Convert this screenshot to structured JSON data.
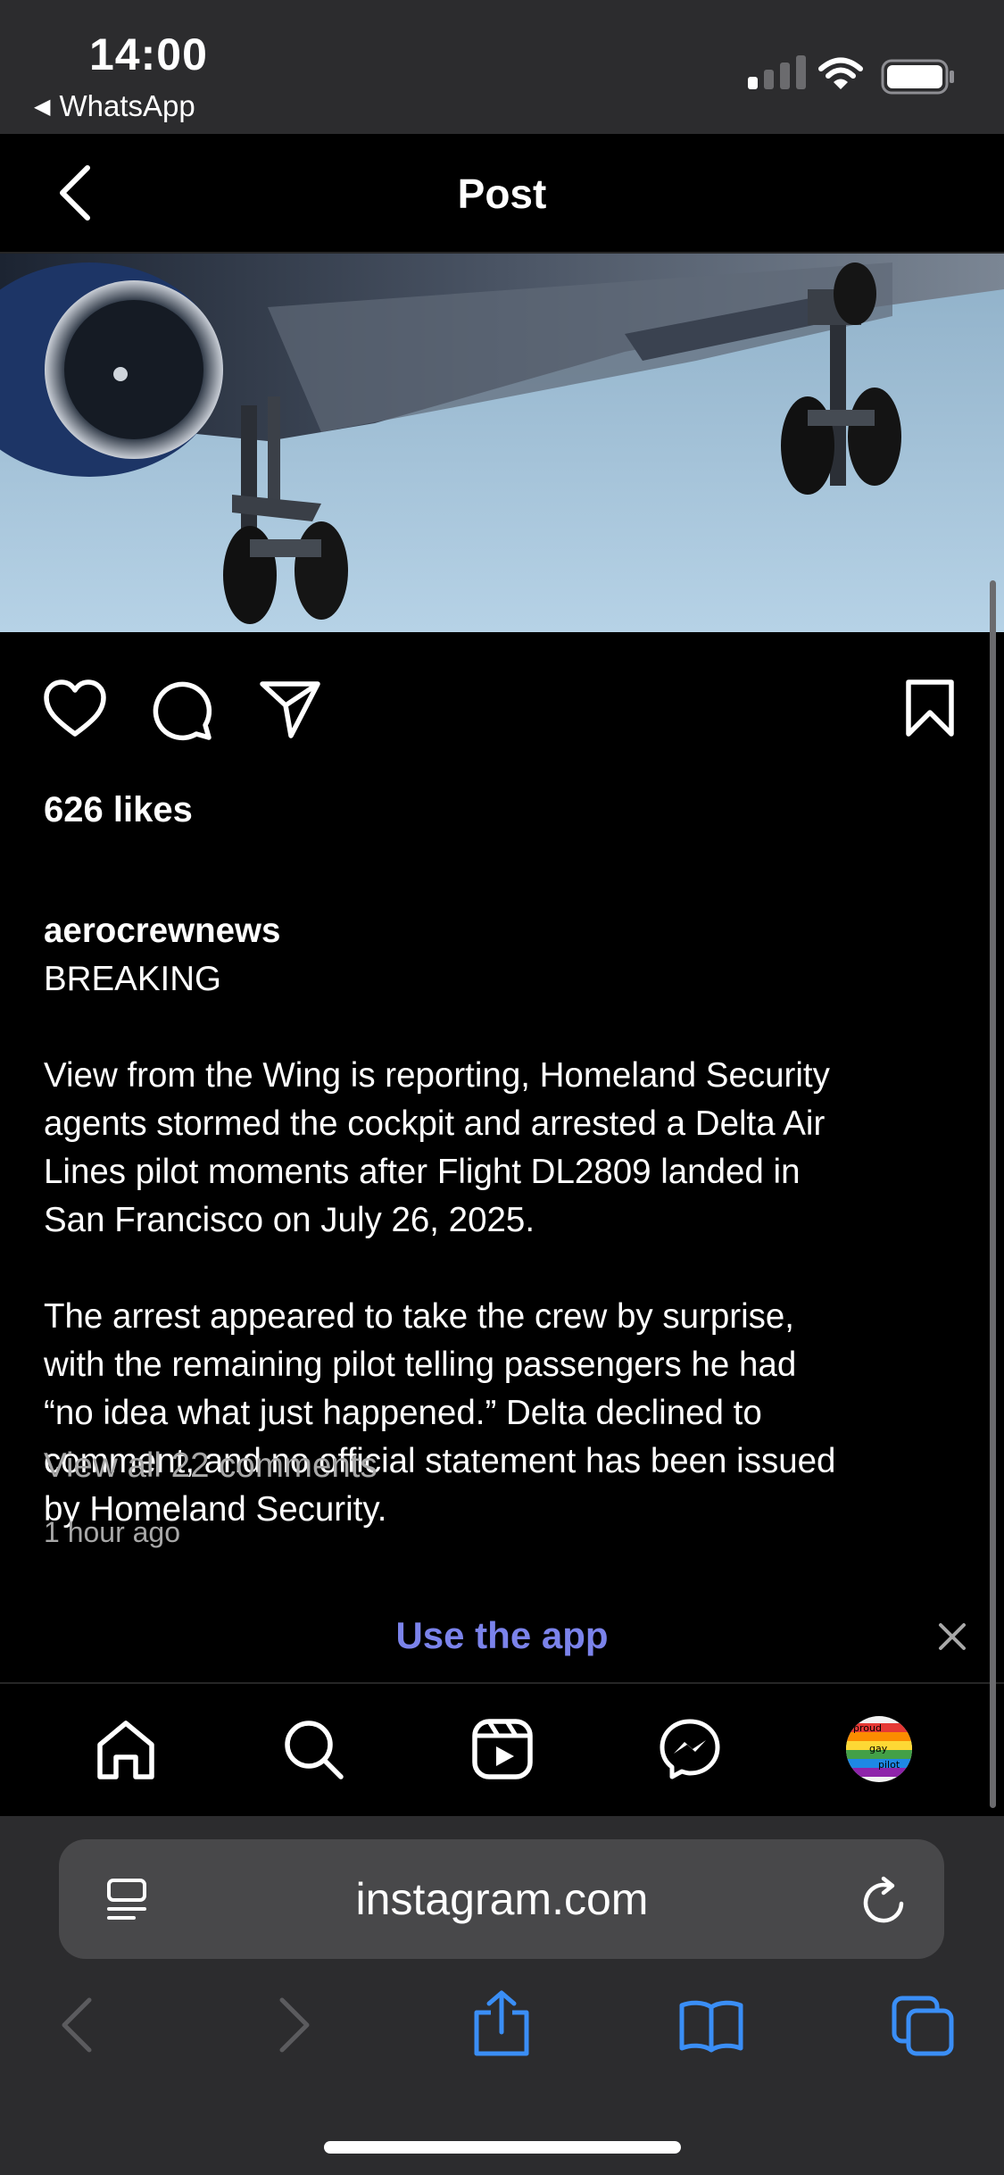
{
  "status_bar": {
    "time": "14:00",
    "back_app": "WhatsApp",
    "icons": [
      "cellular-signal-icon",
      "wifi-icon",
      "battery-icon"
    ]
  },
  "nav": {
    "title": "Post",
    "back_icon": "chevron-left-icon"
  },
  "post": {
    "image_alt": "airplane-undercarriage-photo",
    "actions": [
      "heart-icon",
      "comment-icon",
      "send-icon",
      "bookmark-icon"
    ],
    "likes": "626 likes",
    "username": "aerocrewnews",
    "caption_first_line": "BREAKING",
    "paragraph1": "View from the Wing is reporting, Homeland Security\nagents stormed the cockpit and arrested a Delta Air\nLines pilot moments after Flight DL2809 landed in\nSan Francisco on July 26, 2025.",
    "paragraph2": "The arrest appeared to take the crew by surprise,\nwith the remaining pilot telling passengers he had\n“no idea what just happened.” Delta declined to\ncomment, and no official statement has been issued\nby Homeland Security.",
    "view_comments": "View all 22 comments",
    "time_ago": "1 hour ago"
  },
  "app_banner": {
    "label": "Use the app",
    "close_icon": "close-icon"
  },
  "bottom_nav": {
    "items": [
      "home-icon",
      "search-icon",
      "reels-icon",
      "messenger-icon",
      "profile-avatar"
    ],
    "avatar_text": [
      "proud",
      "gay",
      "pilot"
    ]
  },
  "safari": {
    "url": "instagram.com",
    "icons": [
      "page-menu-icon",
      "reload-icon",
      "back-arrow-icon",
      "forward-arrow-icon",
      "share-icon",
      "bookmarks-icon",
      "tabs-icon"
    ]
  },
  "colors": {
    "accent_link": "#7b83eb",
    "safari_blue": "#3a8ef6",
    "muted_text": "#a8a8a8",
    "chrome_gray": "#2c2c2e"
  }
}
